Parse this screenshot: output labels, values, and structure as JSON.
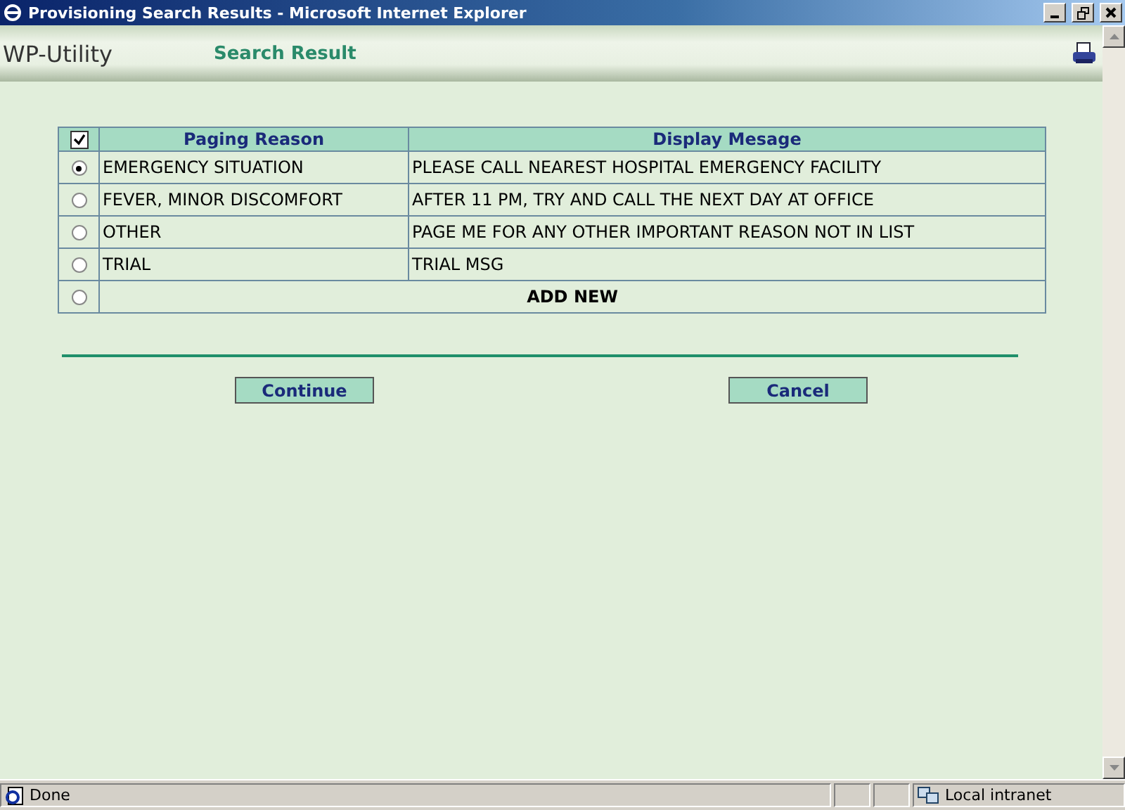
{
  "window": {
    "title": "Provisioning Search Results - Microsoft Internet Explorer"
  },
  "header": {
    "app_name": "WP-Utility",
    "page_title": "Search Result"
  },
  "table": {
    "select_all_checked": true,
    "columns": [
      "Paging Reason",
      "Display Mesage"
    ],
    "rows": [
      {
        "reason": "EMERGENCY SITUATION",
        "message": "PLEASE CALL NEAREST HOSPITAL EMERGENCY FACILITY",
        "selected": true
      },
      {
        "reason": "FEVER, MINOR DISCOMFORT",
        "message": "AFTER 11 PM, TRY AND CALL THE NEXT DAY AT OFFICE",
        "selected": false
      },
      {
        "reason": "OTHER",
        "message": "PAGE ME FOR ANY OTHER IMPORTANT REASON NOT IN LIST",
        "selected": false
      },
      {
        "reason": "TRIAL",
        "message": "TRIAL MSG",
        "selected": false
      }
    ],
    "add_row": {
      "label": "ADD NEW",
      "selected": false
    }
  },
  "buttons": [
    "Continue",
    "Cancel"
  ],
  "status_bar": {
    "status": "Done",
    "zone": "Local intranet"
  }
}
